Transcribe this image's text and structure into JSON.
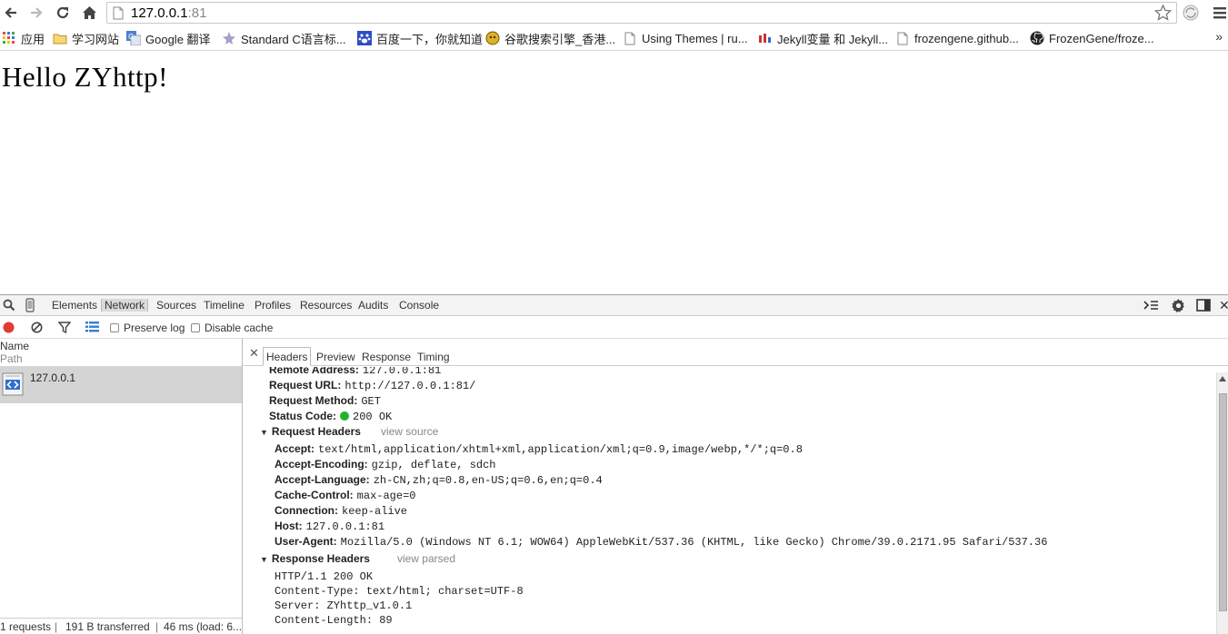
{
  "browser": {
    "url_host": "127.0.0.1",
    "url_port": ":81",
    "colors": {
      "grid_red": "#e84c3d",
      "grid_blue": "#3b7bd5",
      "grid_green": "#4ca64c",
      "grid_yellow": "#f1c40f"
    },
    "icons": [
      "back-icon",
      "forward-icon",
      "reload-icon",
      "home-icon",
      "page-icon",
      "star-icon",
      "extension-icon",
      "menu-icon"
    ]
  },
  "bookmarks": {
    "items": [
      {
        "label": "应用",
        "icon": "apps-grid-icon"
      },
      {
        "label": "学习网站",
        "icon": "folder-icon"
      },
      {
        "label": "Google 翻译",
        "icon": "google-translate-icon"
      },
      {
        "label": "Standard C语言标...",
        "icon": "star-bookmark-icon"
      },
      {
        "label": "百度一下，你就知道",
        "icon": "baidu-icon"
      },
      {
        "label": "谷歌搜索引擎_香港...",
        "icon": "google-hk-icon"
      },
      {
        "label": "Using Themes | ru...",
        "icon": "page-icon"
      },
      {
        "label": "Jekyll变量 和 Jekyll...",
        "icon": "jekyll-icon"
      },
      {
        "label": "frozengene.github...",
        "icon": "page-icon"
      },
      {
        "label": "FrozenGene/froze...",
        "icon": "github-icon"
      }
    ],
    "more": "»"
  },
  "page": {
    "heading": "Hello ZYhttp!"
  },
  "devtools": {
    "tabs": [
      "Elements",
      "Network",
      "Sources",
      "Timeline",
      "Profiles",
      "Resources",
      "Audits",
      "Console"
    ],
    "active_tab": "Network",
    "preserve_log": "Preserve log",
    "disable_cache": "Disable cache",
    "name_header": "Name",
    "path_header": "Path",
    "request_host": "127.0.0.1",
    "status_requests": "1 requests",
    "status_transferred": "191 B transferred",
    "status_time": "46 ms (load: 6...",
    "detail_tabs": [
      "Headers",
      "Preview",
      "Response",
      "Timing"
    ],
    "active_detail_tab": "Headers",
    "general": [
      {
        "key": "Remote Address:",
        "value": "127.0.0.1:81"
      },
      {
        "key": "Request URL:",
        "value": "http://127.0.0.1:81/"
      },
      {
        "key": "Request Method:",
        "value": "GET"
      },
      {
        "key": "Status Code:",
        "value": "200 OK"
      }
    ],
    "request_headers_title": "Request Headers",
    "request_headers_link": "view source",
    "request_headers": [
      {
        "key": "Accept:",
        "value": "text/html,application/xhtml+xml,application/xml;q=0.9,image/webp,*/*;q=0.8"
      },
      {
        "key": "Accept-Encoding:",
        "value": "gzip, deflate, sdch"
      },
      {
        "key": "Accept-Language:",
        "value": "zh-CN,zh;q=0.8,en-US;q=0.6,en;q=0.4"
      },
      {
        "key": "Cache-Control:",
        "value": "max-age=0"
      },
      {
        "key": "Connection:",
        "value": "keep-alive"
      },
      {
        "key": "Host:",
        "value": "127.0.0.1:81"
      },
      {
        "key": "User-Agent:",
        "value": "Mozilla/5.0 (Windows NT 6.1; WOW64) AppleWebKit/537.36 (KHTML, like Gecko) Chrome/39.0.2171.95 Safari/537.36"
      }
    ],
    "response_headers_title": "Response Headers",
    "response_headers_link": "view parsed",
    "response_headers": [
      "HTTP/1.1 200 OK",
      "Content-Type: text/html; charset=UTF-8",
      "Server: ZYhttp_v1.0.1",
      "Content-Length: 89"
    ],
    "status_ok_color": "#28b028",
    "record_color": "#e53935"
  }
}
